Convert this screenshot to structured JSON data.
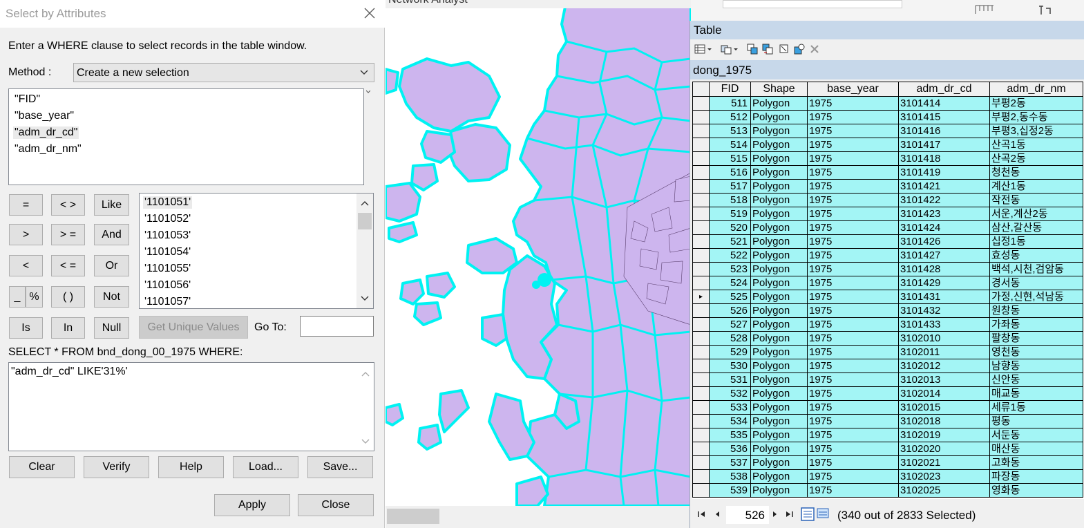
{
  "dialog": {
    "title": "Select by Attributes",
    "instruction": "Enter a WHERE clause to select records in the table window.",
    "method_label": "Method :",
    "method_value": "Create a new selection",
    "fields": [
      "\"FID\"",
      "\"base_year\"",
      "\"adm_dr_cd\"",
      "\"adm_dr_nm\""
    ],
    "selected_field_index": 2,
    "operators": {
      "eq": "=",
      "ne": "< >",
      "like": "Like",
      "gt": ">",
      "ge": "> =",
      "and": "And",
      "lt": "<",
      "le": "< =",
      "or": "Or",
      "underscore": "_",
      "percent": "%",
      "parens": "( )",
      "not": "Not",
      "is": "Is",
      "in": "In",
      "null": "Null"
    },
    "unique_values": [
      "'1101051'",
      "'1101052'",
      "'1101053'",
      "'1101054'",
      "'1101055'",
      "'1101056'",
      "'1101057'"
    ],
    "get_unique_values_label": "Get Unique Values",
    "goto_label": "Go To:",
    "goto_value": "",
    "select_prefix": "SELECT * FROM bnd_dong_00_1975 WHERE:",
    "where_clause": "\"adm_dr_cd\" LIKE'31%'",
    "buttons": {
      "clear": "Clear",
      "verify": "Verify",
      "help": "Help",
      "load": "Load...",
      "save": "Save...",
      "apply": "Apply",
      "close": "Close"
    }
  },
  "map": {
    "top_text": "Network Analyst",
    "fill_color": "#cdb5ee",
    "outline_color": "#00f2f2"
  },
  "table_window": {
    "title": "Table",
    "tab_name": "dong_1975",
    "columns": [
      "FID",
      "Shape",
      "base_year",
      "adm_dr_cd",
      "adm_dr_nm"
    ],
    "rows": [
      {
        "fid": "511",
        "shape": "Polygon",
        "year": "1975",
        "cd": "3101414",
        "nm": "부평2동"
      },
      {
        "fid": "512",
        "shape": "Polygon",
        "year": "1975",
        "cd": "3101415",
        "nm": "부평2,동수동"
      },
      {
        "fid": "513",
        "shape": "Polygon",
        "year": "1975",
        "cd": "3101416",
        "nm": "부평3,십정2동"
      },
      {
        "fid": "514",
        "shape": "Polygon",
        "year": "1975",
        "cd": "3101417",
        "nm": "산곡1동"
      },
      {
        "fid": "515",
        "shape": "Polygon",
        "year": "1975",
        "cd": "3101418",
        "nm": "산곡2동"
      },
      {
        "fid": "516",
        "shape": "Polygon",
        "year": "1975",
        "cd": "3101419",
        "nm": "청천동"
      },
      {
        "fid": "517",
        "shape": "Polygon",
        "year": "1975",
        "cd": "3101421",
        "nm": "계산1동"
      },
      {
        "fid": "518",
        "shape": "Polygon",
        "year": "1975",
        "cd": "3101422",
        "nm": "작전동"
      },
      {
        "fid": "519",
        "shape": "Polygon",
        "year": "1975",
        "cd": "3101423",
        "nm": "서운,계산2동"
      },
      {
        "fid": "520",
        "shape": "Polygon",
        "year": "1975",
        "cd": "3101424",
        "nm": "삼산,갈산동"
      },
      {
        "fid": "521",
        "shape": "Polygon",
        "year": "1975",
        "cd": "3101426",
        "nm": "십정1동"
      },
      {
        "fid": "522",
        "shape": "Polygon",
        "year": "1975",
        "cd": "3101427",
        "nm": "효성동"
      },
      {
        "fid": "523",
        "shape": "Polygon",
        "year": "1975",
        "cd": "3101428",
        "nm": "백석,시천,검암동"
      },
      {
        "fid": "524",
        "shape": "Polygon",
        "year": "1975",
        "cd": "3101429",
        "nm": "경서동"
      },
      {
        "fid": "525",
        "shape": "Polygon",
        "year": "1975",
        "cd": "3101431",
        "nm": "가정,신현,석남동"
      },
      {
        "fid": "526",
        "shape": "Polygon",
        "year": "1975",
        "cd": "3101432",
        "nm": "원창동"
      },
      {
        "fid": "527",
        "shape": "Polygon",
        "year": "1975",
        "cd": "3101433",
        "nm": "가좌동"
      },
      {
        "fid": "528",
        "shape": "Polygon",
        "year": "1975",
        "cd": "3102010",
        "nm": "팔창동"
      },
      {
        "fid": "529",
        "shape": "Polygon",
        "year": "1975",
        "cd": "3102011",
        "nm": "영천동"
      },
      {
        "fid": "530",
        "shape": "Polygon",
        "year": "1975",
        "cd": "3102012",
        "nm": "남향동"
      },
      {
        "fid": "531",
        "shape": "Polygon",
        "year": "1975",
        "cd": "3102013",
        "nm": "신안동"
      },
      {
        "fid": "532",
        "shape": "Polygon",
        "year": "1975",
        "cd": "3102014",
        "nm": "매교동"
      },
      {
        "fid": "533",
        "shape": "Polygon",
        "year": "1975",
        "cd": "3102015",
        "nm": "세류1동"
      },
      {
        "fid": "534",
        "shape": "Polygon",
        "year": "1975",
        "cd": "3102018",
        "nm": "평동"
      },
      {
        "fid": "535",
        "shape": "Polygon",
        "year": "1975",
        "cd": "3102019",
        "nm": "서둔동"
      },
      {
        "fid": "536",
        "shape": "Polygon",
        "year": "1975",
        "cd": "3102020",
        "nm": "매산동"
      },
      {
        "fid": "537",
        "shape": "Polygon",
        "year": "1975",
        "cd": "3102021",
        "nm": "고화동"
      },
      {
        "fid": "538",
        "shape": "Polygon",
        "year": "1975",
        "cd": "3102023",
        "nm": "파장동"
      },
      {
        "fid": "539",
        "shape": "Polygon",
        "year": "1975",
        "cd": "3102025",
        "nm": "영화동"
      }
    ],
    "current_row_fid": "525",
    "record_number": "526",
    "selection_status": "(340 out of 2833 Selected)",
    "selected_row_color": "#a3f5f5"
  }
}
